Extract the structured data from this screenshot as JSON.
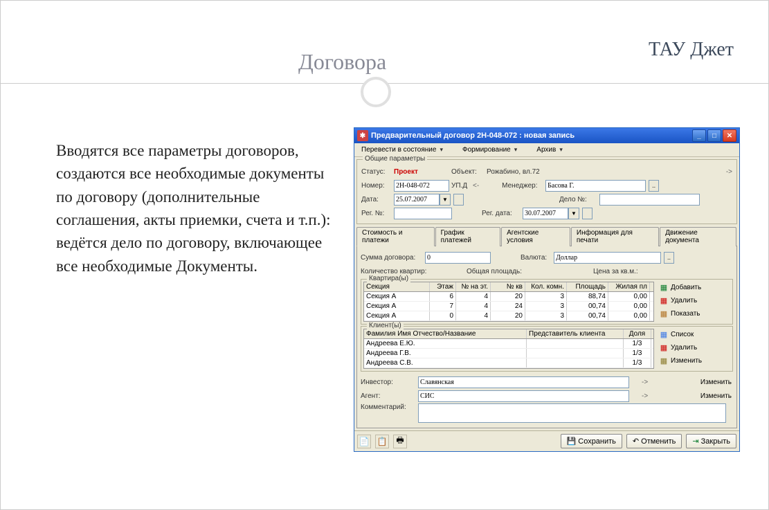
{
  "slide": {
    "title": "Договора",
    "brand": "ТАУ Джет",
    "body": "Вводятся все параметры договоров, создаются все необходимые документы по договору (дополнительные соглашения, акты приемки, счета и т.п.): ведётся дело по договору, включающее все необходимые Документы."
  },
  "app": {
    "title": "Предварительный договор 2H-048-072 : новая запись",
    "toolbar": {
      "state": "Перевести в состояние",
      "forming": "Формирование",
      "archive": "Архив"
    },
    "common_legend": "Общие параметры",
    "labels": {
      "status": "Статус:",
      "object": "Объект:",
      "number": "Номер:",
      "pd": "УП.Д",
      "manager": "Менеджер:",
      "date": "Дата:",
      "dealnum": "Дело №:",
      "regnum": "Рег. №:",
      "regdate": "Рег. дата:",
      "contract_sum": "Сумма договора:",
      "currency": "Валюта:",
      "apt_count": "Количество квартир:",
      "total_area": "Общая площадь:",
      "price_m2": "Цена за кв.м.:",
      "apartments": "Квартира(ы)",
      "clients": "Клиент(ы)",
      "investor": "Инвестор:",
      "agent": "Агент:",
      "comment": "Комментарий:"
    },
    "values": {
      "status": "Проект",
      "object": "Рожабино, вл.72",
      "number": "2H-048-072",
      "pd": "<-",
      "manager": "Басова Г.",
      "date": "25.07.2007",
      "dealnum": "",
      "regnum": "",
      "regdate": "30.07.2007",
      "contract_sum": "0",
      "currency": "Доллар",
      "investor": "Славянская",
      "agent": "СИС",
      "comment": ""
    },
    "tabs": [
      "Стоимость и платежи",
      "График платежей",
      "Агентские условия",
      "Информация для печати",
      "Движение документа"
    ],
    "apt_cols": [
      "Секция",
      "Этаж",
      "№ на эт.",
      "№ кв",
      "Кол. комн.",
      "Площадь",
      "Жилая пл"
    ],
    "apt_rows": [
      {
        "sec": "Секция А",
        "et": "6",
        "net": "4",
        "nkv": "20",
        "kk": "3",
        "pl": "88,74",
        "jp": "0,00"
      },
      {
        "sec": "Секция А",
        "et": "7",
        "net": "4",
        "nkv": "24",
        "kk": "3",
        "pl": "00,74",
        "jp": "0,00"
      },
      {
        "sec": "Секция А",
        "et": "0",
        "net": "4",
        "nkv": "20",
        "kk": "3",
        "pl": "00,74",
        "jp": "0,00"
      }
    ],
    "cli_cols": [
      "Фамилия Имя Отчество/Название",
      "Представитель клиента",
      "Доля"
    ],
    "cli_rows": [
      {
        "name": "Андреева Е.Ю.",
        "rep": "",
        "share": "1/3"
      },
      {
        "name": "Андреева Г.В.",
        "rep": "",
        "share": "1/3"
      },
      {
        "name": "Андреева С.В.",
        "rep": "",
        "share": "1/3"
      }
    ],
    "side": {
      "add": "Добавить",
      "del": "Удалить",
      "show": "Показать",
      "list": "Список",
      "edit": "Изменить",
      "arrow": "->"
    },
    "bottombtns": {
      "save": "Сохранить",
      "cancel": "Отменить",
      "close": "Закрыть"
    }
  }
}
